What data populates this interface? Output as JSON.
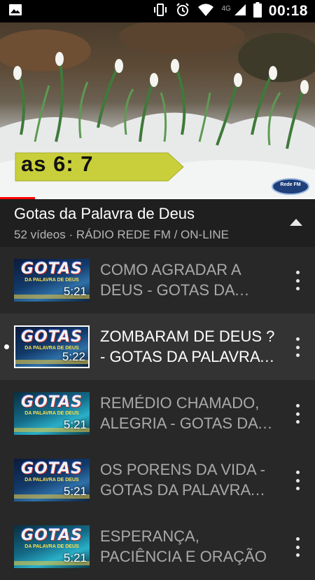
{
  "status_bar": {
    "network": "4G",
    "time": "00:18"
  },
  "player": {
    "overlay_text": "as 6: 7",
    "watermark": "Rede FM",
    "progress": 0.11
  },
  "playlist": {
    "title": "Gotas da Palavra de Deus",
    "subtitle": "52 vídeos · RÁDIO REDE FM / ON-LINE"
  },
  "thumbnail_logo": "GOTAS",
  "thumbnail_logo_sub": "DA PALAVRA DE DEUS",
  "videos": [
    {
      "title": "COMO AGRADAR A DEUS - GOTAS DA PALAVRA DE DEUS",
      "duration": "5:21"
    },
    {
      "title": "ZOMBARAM DE DEUS ? - GOTAS DA PALAVRA DE DEUS",
      "duration": "5:22"
    },
    {
      "title": "REMÉDIO CHAMADO, ALEGRIA - GOTAS DA PALAVRA DE DEUS",
      "duration": "5:21"
    },
    {
      "title": "OS PORENS DA VIDA - GOTAS DA PALAVRA DE DEUS",
      "duration": "5:21"
    },
    {
      "title": "ESPERANÇA, PACIÊNCIA E ORAÇÃO",
      "duration": "5:21"
    }
  ],
  "colors": {
    "background": "#282828",
    "header_bg": "#1f1f1f",
    "active_row": "#333333",
    "progress": "#ff0000",
    "overlay_banner": "#c9cf3a"
  }
}
